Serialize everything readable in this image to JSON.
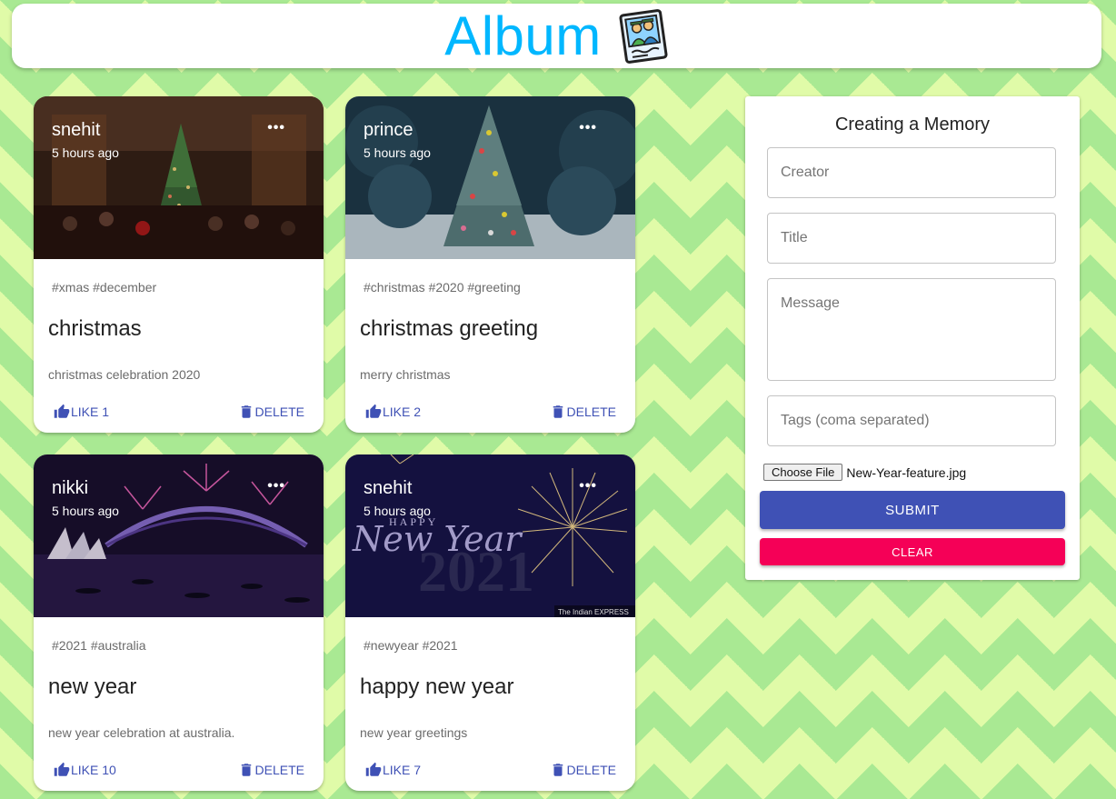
{
  "header": {
    "title": "Album",
    "icon": "photo-album-icon"
  },
  "colors": {
    "brand": "#00b7ff",
    "primary": "#3f51b5",
    "secondary": "#f50057"
  },
  "posts": [
    {
      "creator": "snehit",
      "time": "5 hours ago",
      "tags": "#xmas #december",
      "title": "christmas",
      "message": "christmas celebration 2020",
      "like": "LIKE 1",
      "delete": "DELETE",
      "image": "christmas-crowd-photo"
    },
    {
      "creator": "prince",
      "time": "5 hours ago",
      "tags": "#christmas #2020 #greeting",
      "title": "christmas greeting",
      "message": "merry christmas",
      "like": "LIKE 2",
      "delete": "DELETE",
      "image": "christmas-tree-photo"
    },
    {
      "creator": "nikki",
      "time": "5 hours ago",
      "tags": "#2021 #australia",
      "title": "new year",
      "message": "new year celebration at australia.",
      "like": "LIKE 10",
      "delete": "DELETE",
      "image": "sydney-fireworks-photo"
    },
    {
      "creator": "snehit",
      "time": "5 hours ago",
      "tags": "#newyear #2021",
      "title": "happy new year",
      "message": "new year greetings",
      "like": "LIKE 7",
      "delete": "DELETE",
      "image": "happy-new-year-banner",
      "image_text": {
        "happy": "HAPPY",
        "new_year": "New Year",
        "year": "2021",
        "credit": "The Indian EXPRESS"
      }
    }
  ],
  "form": {
    "title": "Creating a Memory",
    "creator_placeholder": "Creator",
    "title_placeholder": "Title",
    "message_placeholder": "Message",
    "tags_placeholder": "Tags (coma separated)",
    "choose_file": "Choose File",
    "file_name": "New-Year-feature.jpg",
    "submit": "SUBMIT",
    "clear": "CLEAR"
  }
}
